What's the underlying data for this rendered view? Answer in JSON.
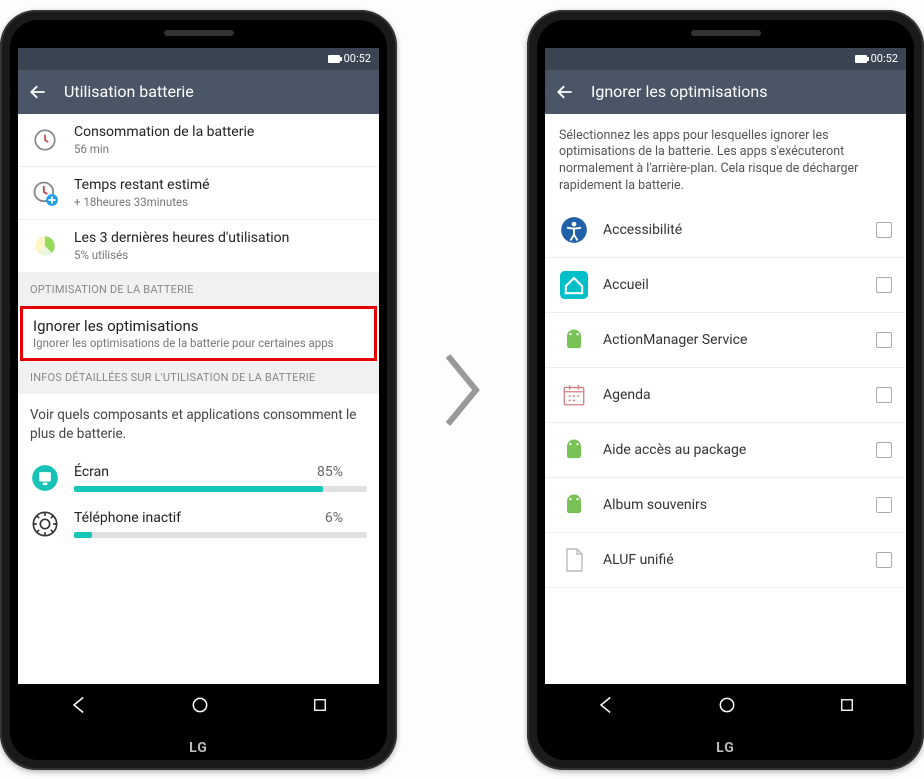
{
  "status": {
    "time": "00:52"
  },
  "left": {
    "title": "Utilisation batterie",
    "rows": [
      {
        "title": "Consommation de la batterie",
        "sub": "56 min"
      },
      {
        "title": "Temps restant estimé",
        "sub": "+ 18heures 33minutes"
      },
      {
        "title": "Les 3 dernières heures d'utilisation",
        "sub": "5% utilisés"
      }
    ],
    "section1": "OPTIMISATION DE LA BATTERIE",
    "ignore": {
      "title": "Ignorer les optimisations",
      "sub": "Ignorer les optimisations de la batterie pour certaines apps"
    },
    "section2": "INFOS DÉTAILLÉES SUR L'UTILISATION DE LA BATTERIE",
    "plain": "Voir quels composants et applications consomment le plus de batterie.",
    "usage": [
      {
        "name": "Écran",
        "pct": "85%",
        "pctnum": 85
      },
      {
        "name": "Téléphone inactif",
        "pct": "6%",
        "pctnum": 6
      }
    ]
  },
  "right": {
    "title": "Ignorer les optimisations",
    "desc": "Sélectionnez les apps pour lesquelles ignorer les optimisations de la batterie. Les apps s'exécuteront normalement à l'arrière-plan. Cela risque de décharger rapidement la batterie.",
    "apps": [
      "Accessibilité",
      "Accueil",
      "ActionManager Service",
      "Agenda",
      "Aide accès au package",
      "Album souvenirs",
      "ALUF unifié"
    ]
  },
  "logo": "LG"
}
